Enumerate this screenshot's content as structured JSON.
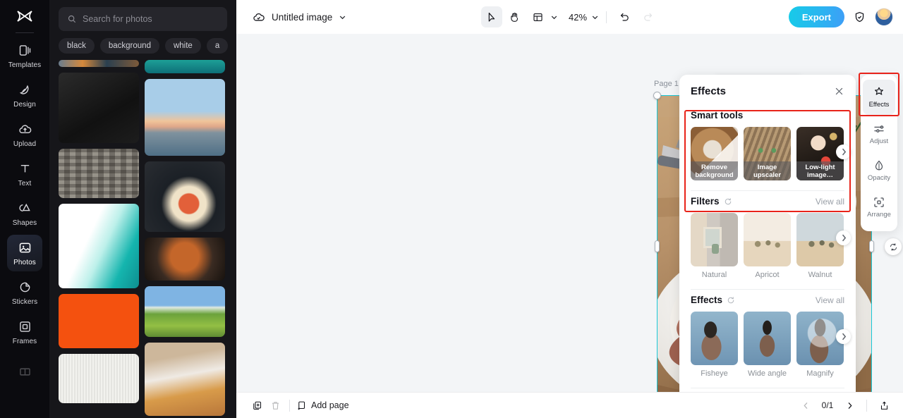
{
  "app": {
    "logo_icon": "capcut-logo-icon"
  },
  "rail": {
    "items": [
      {
        "label": "Templates",
        "icon": "templates-icon",
        "active": false
      },
      {
        "label": "Design",
        "icon": "design-icon",
        "active": false
      },
      {
        "label": "Upload",
        "icon": "upload-cloud-icon",
        "active": false
      },
      {
        "label": "Text",
        "icon": "text-icon",
        "active": false
      },
      {
        "label": "Shapes",
        "icon": "shapes-icon",
        "active": false
      },
      {
        "label": "Photos",
        "icon": "photos-icon",
        "active": true
      },
      {
        "label": "Stickers",
        "icon": "stickers-icon",
        "active": false
      },
      {
        "label": "Frames",
        "icon": "frames-icon",
        "active": false
      }
    ]
  },
  "panel": {
    "search": {
      "placeholder": "Search for photos",
      "icon": "search-icon"
    },
    "tags": [
      "black",
      "background",
      "white",
      "a"
    ],
    "collapse_icon": "chevron-left-icon"
  },
  "topbar": {
    "cloud_icon": "cloud-saved-icon",
    "doc_name": "Untitled image",
    "doc_chevron": "chevron-down-icon",
    "tools": [
      {
        "name": "select-tool",
        "icon": "cursor-arrow-icon",
        "active": true
      },
      {
        "name": "hand-tool",
        "icon": "hand-icon",
        "active": false
      },
      {
        "name": "layout-tool",
        "icon": "layout-grid-icon",
        "active": false
      }
    ],
    "zoom_value": "42%",
    "undo_icon": "undo-icon",
    "redo_icon": "redo-icon",
    "export_label": "Export",
    "shield_icon": "shield-check-icon",
    "avatar": "user-avatar",
    "export_color": "#1fc4ec"
  },
  "canvas": {
    "page_label": "Page 1",
    "selection_color": "#19c8d8",
    "rotate_icon": "rotate-icon",
    "float_toolbar": [
      {
        "name": "crop-button",
        "icon": "crop-icon"
      },
      {
        "name": "replace-button",
        "icon": "replace-swap-icon"
      },
      {
        "name": "duplicate-button",
        "icon": "duplicate-icon"
      },
      {
        "name": "more-button",
        "icon": "more-horizontal-icon"
      }
    ]
  },
  "effects_panel": {
    "title": "Effects",
    "close_icon": "close-icon",
    "annotation_color": "#e8231a",
    "sections": [
      {
        "title": "Smart tools",
        "has_reset": false,
        "view_all": "",
        "cards": [
          {
            "caption": "Remove background",
            "label": ""
          },
          {
            "caption": "Image upscaler",
            "label": ""
          },
          {
            "caption": "Low-light image…",
            "label": ""
          }
        ]
      },
      {
        "title": "Filters",
        "has_reset": true,
        "view_all": "View all",
        "cards": [
          {
            "caption": "",
            "label": "Natural"
          },
          {
            "caption": "",
            "label": "Apricot"
          },
          {
            "caption": "",
            "label": "Walnut"
          }
        ]
      },
      {
        "title": "Effects",
        "has_reset": true,
        "view_all": "View all",
        "cards": [
          {
            "caption": "",
            "label": "Fisheye"
          },
          {
            "caption": "",
            "label": "Wide angle"
          },
          {
            "caption": "",
            "label": "Magnify"
          }
        ]
      }
    ]
  },
  "right_rail": {
    "items": [
      {
        "label": "Effects",
        "icon": "sparkle-star-icon",
        "active": true
      },
      {
        "label": "Adjust",
        "icon": "sliders-icon",
        "active": false
      },
      {
        "label": "Opacity",
        "icon": "droplet-icon",
        "active": false
      },
      {
        "label": "Arrange",
        "icon": "arrange-icon",
        "active": false
      }
    ]
  },
  "bottom": {
    "duplicate_icon": "duplicate-page-icon",
    "delete_icon": "trash-icon",
    "add_page_label": "Add page",
    "add_page_icon": "add-page-icon",
    "prev_icon": "chevron-left-icon",
    "page_indicator": "0/1",
    "next_icon": "chevron-right-icon",
    "timeline_icon": "export-tray-icon"
  }
}
